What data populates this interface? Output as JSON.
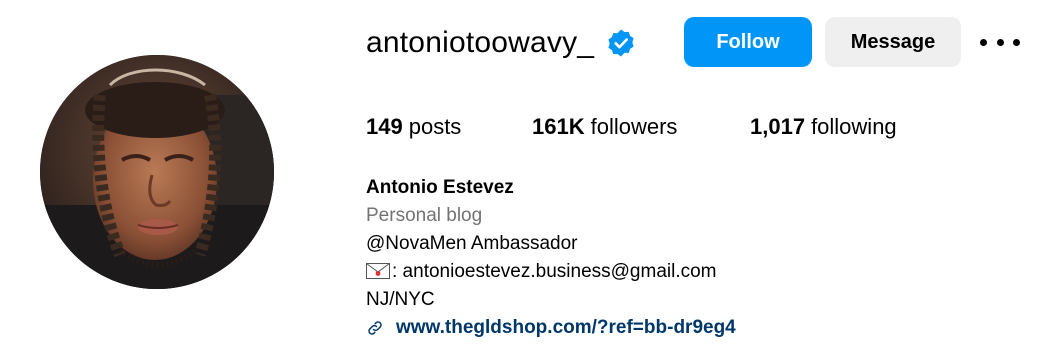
{
  "profile": {
    "username": "antoniotoowavy_",
    "verified_icon": "verified-badge-icon",
    "follow_label": "Follow",
    "message_label": "Message",
    "more_icon": "more-options-icon"
  },
  "stats": {
    "posts_count": "149",
    "posts_label": "posts",
    "followers_count": "161K",
    "followers_label": "followers",
    "following_count": "1,017",
    "following_label": "following"
  },
  "bio": {
    "full_name": "Antonio Estevez",
    "category": "Personal blog",
    "line1": "@NovaMen Ambassador",
    "email_icon": "envelope-icon",
    "email_line": ": antonioestevez.business@gmail.com",
    "location": "NJ/NYC",
    "link_icon": "link-icon",
    "link": "www.thegldshop.com/?ref=bb-dr9eg4"
  },
  "colors": {
    "follow_button": "#0095f6",
    "message_button": "#efefef",
    "verified_badge": "#0095f6",
    "category_text": "#737373",
    "link_text": "#00376b"
  }
}
